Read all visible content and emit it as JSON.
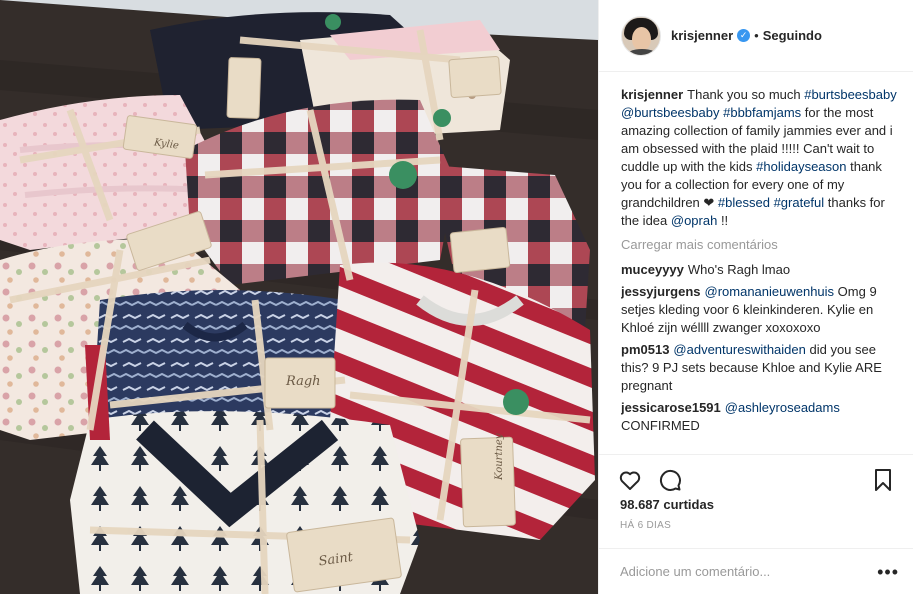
{
  "post": {
    "username": "krisjenner",
    "separator": "•",
    "follow_status": "Seguindo",
    "image_alt": "Stacks of folded Burt's Bees Baby family pajamas tied with ribbons and name tags",
    "tag_names": [
      "Kylie",
      "Ragh",
      "Saint",
      "Kourtney"
    ]
  },
  "caption": {
    "username": "krisjenner",
    "t1": "Thank you so much ",
    "h1": "#burtsbeesbaby",
    "t2": " ",
    "m1": "@burtsbeesbaby",
    "t3": " ",
    "h2": "#bbbfamjams",
    "t4": " for the most amazing collection of family jammies ever and i am obsessed with the plaid !!!!! Can't wait to cuddle up with the kids ",
    "h3": "#holidayseason",
    "t5": " thank you for a collection for every one of my grandchildren ❤ ",
    "h4": "#blessed",
    "t6": " ",
    "h5": "#grateful",
    "t7": " thanks for the idea ",
    "m2": "@oprah",
    "t8": " !!"
  },
  "load_more": "Carregar mais comentários",
  "comments": [
    {
      "user": "muceyyyy",
      "pre": "",
      "mention": "",
      "text": "Who's Ragh lmao"
    },
    {
      "user": "jessyjurgens",
      "pre": "",
      "mention": "@romananieuwenhuis",
      "text": " Omg 9 setjes kleding voor 6 kleinkinderen. Kylie en Khloé zijn wéllll zwanger xoxoxoxo"
    },
    {
      "user": "pm0513",
      "pre": "",
      "mention": "@adventureswithaiden",
      "text": " did you see this? 9 PJ sets because Khloe and Kylie ARE pregnant"
    },
    {
      "user": "jessicarose1591",
      "pre": "",
      "mention": "@ashleyroseadams",
      "text": " CONFIRMED"
    }
  ],
  "likes": "98.687 curtidas",
  "time_ago": "Há 6 dias",
  "add_comment_placeholder": "Adicione um comentário...",
  "more_label": "•••",
  "icons": [
    "heart-icon",
    "comment-icon",
    "bookmark-icon",
    "verified-icon",
    "more-icon"
  ],
  "colors": {
    "link": "#003569",
    "verified": "#3897f0",
    "muted": "#999999",
    "text": "#262626"
  }
}
